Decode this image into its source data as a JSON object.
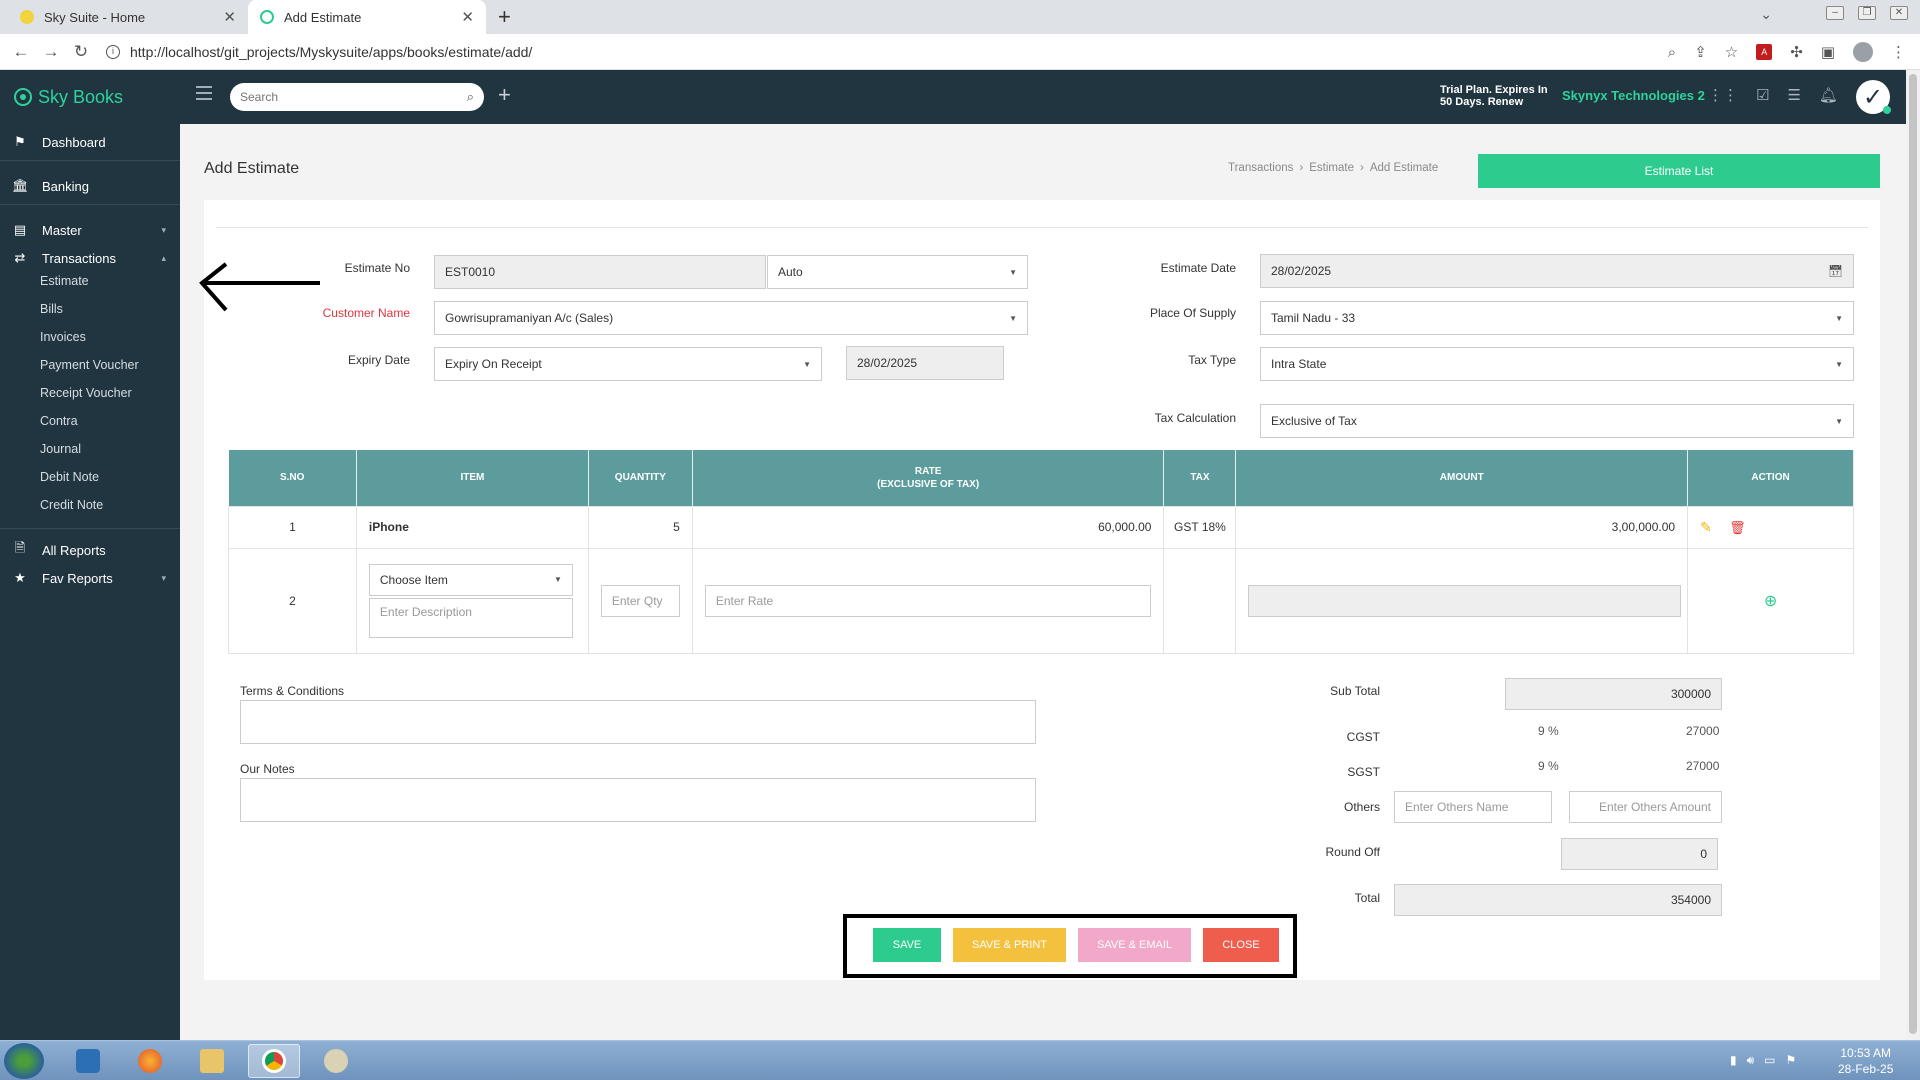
{
  "browser": {
    "tabs": [
      {
        "label": "Sky Suite - Home",
        "active": false
      },
      {
        "label": "Add Estimate",
        "active": true
      }
    ],
    "url": "http://localhost/git_projects/Myskysuite/apps/books/estimate/add/"
  },
  "header": {
    "brand": "Sky Books",
    "search_placeholder": "Search",
    "trial_line1": "Trial Plan. Expires In",
    "trial_line2": "50 Days. Renew",
    "company": "Skynyx Technologies 2"
  },
  "sidebar": {
    "items": [
      {
        "label": "Dashboard",
        "icon": "flag-icon"
      },
      {
        "label": "Banking",
        "icon": "bank-icon"
      },
      {
        "label": "Master",
        "icon": "layers-icon"
      },
      {
        "label": "Transactions",
        "icon": "exchange-icon"
      },
      {
        "label": "All Reports",
        "icon": "report-icon"
      },
      {
        "label": "Fav Reports",
        "icon": "star-icon"
      }
    ],
    "sub_items": [
      "Estimate",
      "Bills",
      "Invoices",
      "Payment Voucher",
      "Receipt Voucher",
      "Contra",
      "Journal",
      "Debit Note",
      "Credit Note"
    ]
  },
  "page": {
    "title": "Add Estimate",
    "breadcrumb": [
      "Transactions",
      "Estimate",
      "Add Estimate"
    ],
    "estimate_list_label": "Estimate List"
  },
  "form": {
    "estimate_no_label": "Estimate No",
    "estimate_no": "EST0010",
    "estimate_no_mode": "Auto",
    "customer_label": "Customer Name",
    "customer": "Gowrisupramaniyan A/c (Sales)",
    "expiry_label": "Expiry Date",
    "expiry_mode": "Expiry On Receipt",
    "expiry_date": "28/02/2025",
    "estimate_date_label": "Estimate Date",
    "estimate_date": "28/02/2025",
    "place_label": "Place Of Supply",
    "place": "Tamil Nadu - 33",
    "tax_type_label": "Tax Type",
    "tax_type": "Intra State",
    "tax_calc_label": "Tax Calculation",
    "tax_calc": "Exclusive of Tax"
  },
  "table": {
    "headers": {
      "sno": "S.NO",
      "item": "ITEM",
      "qty": "QUANTITY",
      "rate1": "RATE",
      "rate2": "(EXCLUSIVE OF TAX)",
      "tax": "TAX",
      "amount": "AMOUNT",
      "action": "ACTION"
    },
    "rows": [
      {
        "sno": "1",
        "item": "iPhone",
        "qty": "5",
        "rate": "60,000.00",
        "tax": "GST 18%",
        "amount": "3,00,000.00"
      }
    ],
    "new_row": {
      "sno": "2",
      "item_placeholder": "Choose Item",
      "desc_placeholder": "Enter Description",
      "qty_placeholder": "Enter Qty",
      "rate_placeholder": "Enter Rate"
    }
  },
  "notes": {
    "terms_label": "Terms & Conditions",
    "notes_label": "Our Notes"
  },
  "totals": {
    "subtotal_label": "Sub Total",
    "subtotal": "300000",
    "cgst_label": "CGST",
    "cgst_rate": "9 %",
    "cgst": "27000",
    "sgst_label": "SGST",
    "sgst_rate": "9 %",
    "sgst": "27000",
    "others_label": "Others",
    "others_name_placeholder": "Enter Others Name",
    "others_amount_placeholder": "Enter Others Amount",
    "roundoff_label": "Round Off",
    "roundoff": "0",
    "total_label": "Total",
    "total": "354000"
  },
  "actions": {
    "save": "SAVE",
    "save_print": "SAVE & PRINT",
    "save_email": "SAVE & EMAIL",
    "close": "CLOSE"
  },
  "colors": {
    "header_bg": "#213540",
    "brand_green": "#2dd29b",
    "table_header": "#5c9c9c",
    "save": "#2dcb8e",
    "save_print": "#f4c13f",
    "save_email": "#f2a8c8",
    "close": "#ef5d4c"
  },
  "taskbar": {
    "time": "10:53 AM",
    "date": "28-Feb-25"
  }
}
